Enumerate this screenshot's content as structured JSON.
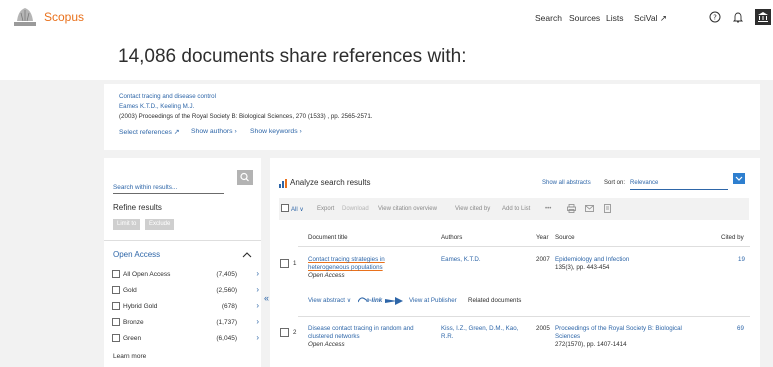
{
  "header": {
    "brand": "Scopus",
    "nav": [
      "Search",
      "Sources",
      "Lists",
      "SciVal ↗"
    ],
    "help_icon": "question-circle-icon",
    "bell_icon": "bell-icon",
    "institution_icon": "institution-icon"
  },
  "page": {
    "title": "14,086 documents share references with:"
  },
  "reference": {
    "title": "Contact tracing and disease control",
    "authors": "Eames K.T.D., Keeling M.J.",
    "citation": "(2003) Proceedings of the Royal Society B: Biological Sciences, 270 (1533) , pp. 2565-2571.",
    "select_refs": "Select references ↗",
    "show_authors": "Show authors ›",
    "show_keywords": "Show keywords ›"
  },
  "sidebar": {
    "search_placeholder": "Search within results...",
    "refine_title": "Refine results",
    "limit_to": "Limit to",
    "exclude": "Exclude",
    "facet_title": "Open Access",
    "facets": [
      {
        "label": "All Open Access",
        "count": "(7,405)"
      },
      {
        "label": "Gold",
        "count": "(2,560)"
      },
      {
        "label": "Hybrid Gold",
        "count": "(678)"
      },
      {
        "label": "Bronze",
        "count": "(1,737)"
      },
      {
        "label": "Green",
        "count": "(6,045)"
      }
    ],
    "learn_more": "Learn more"
  },
  "results": {
    "analyze": "Analyze search results",
    "show_abstracts": "Show all abstracts",
    "sort_label": "Sort on:",
    "sort_value": "Relevance",
    "toolbar": {
      "all": "All",
      "export": "Export",
      "download": "Download",
      "citation_overview": "View citation overview",
      "cited_by": "View cited by",
      "add_to_list": "Add to List",
      "more": "•••"
    },
    "columns": {
      "title": "Document title",
      "authors": "Authors",
      "year": "Year",
      "source": "Source",
      "cited_by": "Cited by"
    },
    "rows": [
      {
        "num": "1",
        "title_line1": "Contact tracing strategies in",
        "title_line2": "heterogeneous populations",
        "access": "Open Access",
        "authors": "Eames, K.T.D.",
        "year": "2007",
        "source_line1": "Epidemiology and Infection",
        "source_line2": "135(3), pp. 443-454",
        "cited": "19",
        "view_abstract": "View abstract ∨",
        "elink": "e-link",
        "view_publisher": "View at Publisher",
        "related": "Related documents"
      },
      {
        "num": "2",
        "title_line1": "Disease contact tracing in random and",
        "title_line2": "clustered networks",
        "access": "Open Access",
        "authors_line1": "Kiss, I.Z., Green, D.M., Kao,",
        "authors_line2": "R.R.",
        "year": "2005",
        "source_line1": "Proceedings of the Royal Society B: Biological",
        "source_line2": "Sciences",
        "source_line3": "272(1570), pp. 1407-1414",
        "cited": "69"
      }
    ]
  },
  "colors": {
    "brand_orange": "#e9711c",
    "link_blue": "#2e66a8",
    "background_gray": "#f2f2f2"
  }
}
